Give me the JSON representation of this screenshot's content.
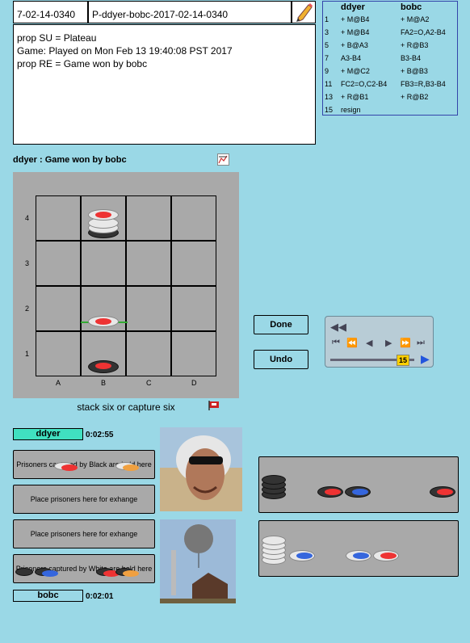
{
  "header": {
    "game_id_short": "7-02-14-0340",
    "game_id_full": "P-ddyer-bobc-2017-02-14-0340",
    "edit_icon": "pencil-icon"
  },
  "properties": {
    "lines": [
      "prop SU = Plateau",
      "Game: Played on Mon Feb 13 19:40:08 PST 2017",
      "prop RE = Game won by bobc"
    ]
  },
  "move_list": {
    "player1": "ddyer",
    "player2": "bobc",
    "rows": [
      {
        "n": "1",
        "a": "+ M@B4",
        "b": "+ M@A2"
      },
      {
        "n": "3",
        "a": "+ M@B4",
        "b": "FA2=O,A2-B4"
      },
      {
        "n": "5",
        "a": "+ B@A3",
        "b": "+ R@B3"
      },
      {
        "n": "7",
        "a": "A3-B4",
        "b": "B3-B4"
      },
      {
        "n": "9",
        "a": "+ M@C2",
        "b": "+ B@B3"
      },
      {
        "n": "11",
        "a": "FC2=O,C2-B4",
        "b": "FB3=R,B3-B4"
      },
      {
        "n": "13",
        "a": "+ R@B1",
        "b": "+ R@B2"
      },
      {
        "n": "15",
        "a": "resign",
        "b": ""
      }
    ]
  },
  "board": {
    "status": "ddyer : Game won by bobc",
    "caption": "stack six or capture six",
    "ranks": [
      "4",
      "3",
      "2",
      "1"
    ],
    "files": [
      "A",
      "B",
      "C",
      "D"
    ]
  },
  "buttons": {
    "done": "Done",
    "undo": "Undo"
  },
  "playback": {
    "move_number": "15"
  },
  "players": {
    "top_name": "ddyer",
    "top_time": "0:02:55",
    "bottom_name": "bobc",
    "bottom_time": "0:02:01",
    "top_accent": "#40e0c0"
  },
  "trays": {
    "prisoners_black": "Prisoners captured by Black are held here",
    "exchange_1": "Place prisoners here for exhange",
    "exchange_2": "Place prisoners here for exhange",
    "prisoners_white": "Prisoners captured by White are held here"
  }
}
